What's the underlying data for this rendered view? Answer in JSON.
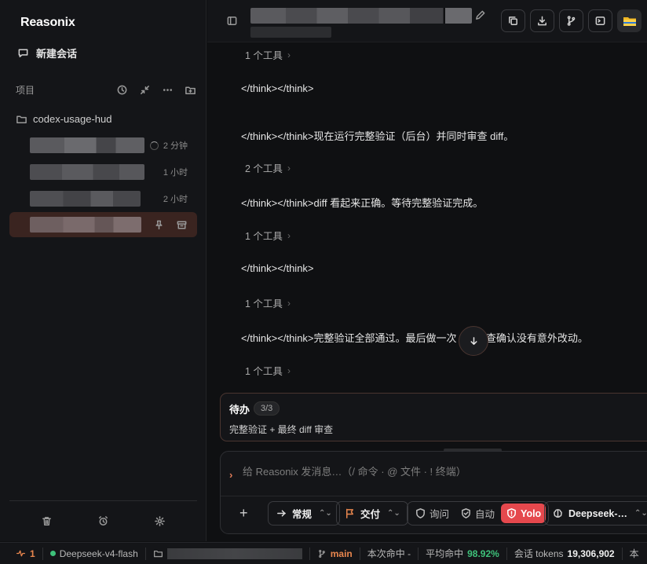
{
  "app": {
    "brand": "Reasonix"
  },
  "sidebar": {
    "new_chat": "新建会话",
    "project_label": "项目",
    "folder_name": "codex-usage-hud",
    "sessions": [
      {
        "time": "2 分钟"
      },
      {
        "time": "1 小时"
      },
      {
        "time": "2 小时"
      },
      {
        "time": ""
      }
    ]
  },
  "conversation": {
    "tool_1": "1 个工具",
    "msg_1": "</think></think>",
    "msg_2": "</think></think>现在运行完整验证（后台）并同时审查 diff。",
    "tool_2": "2 个工具",
    "msg_3": "</think></think>diff 看起来正确。等待完整验证完成。",
    "tool_3": "1 个工具",
    "msg_4": "</think></think>",
    "tool_4": "1 个工具",
    "msg_5": "</think></think>完整验证全部通过。最后做一次 diff 审查确认没有意外改动。",
    "tool_5": "1 个工具"
  },
  "todo": {
    "title": "待办",
    "count": "3/3",
    "item": "完整验证 + 最终 diff 审查"
  },
  "composer": {
    "placeholder": "给 Reasonix 发消息…（/ 命令 · @ 文件 · ! 终端）",
    "plan_label": "常规",
    "deliver_label": "交付",
    "mode_ask": "询问",
    "mode_auto": "自动",
    "mode_yolo": "Yolo",
    "model_label": "Deepseek-…"
  },
  "status": {
    "pulse_count": "1",
    "model": "Deepseek-v4-flash",
    "branch": "main",
    "hit_label": "本次命中 -",
    "avg_label": "平均命中",
    "avg_value": "98.92%",
    "tokens_label": "会话 tokens",
    "tokens_value": "19,306,902",
    "trailing": "本"
  },
  "colors": {
    "accent": "#e5484d",
    "active_session": "#3a2420",
    "success": "#3ec17a"
  }
}
